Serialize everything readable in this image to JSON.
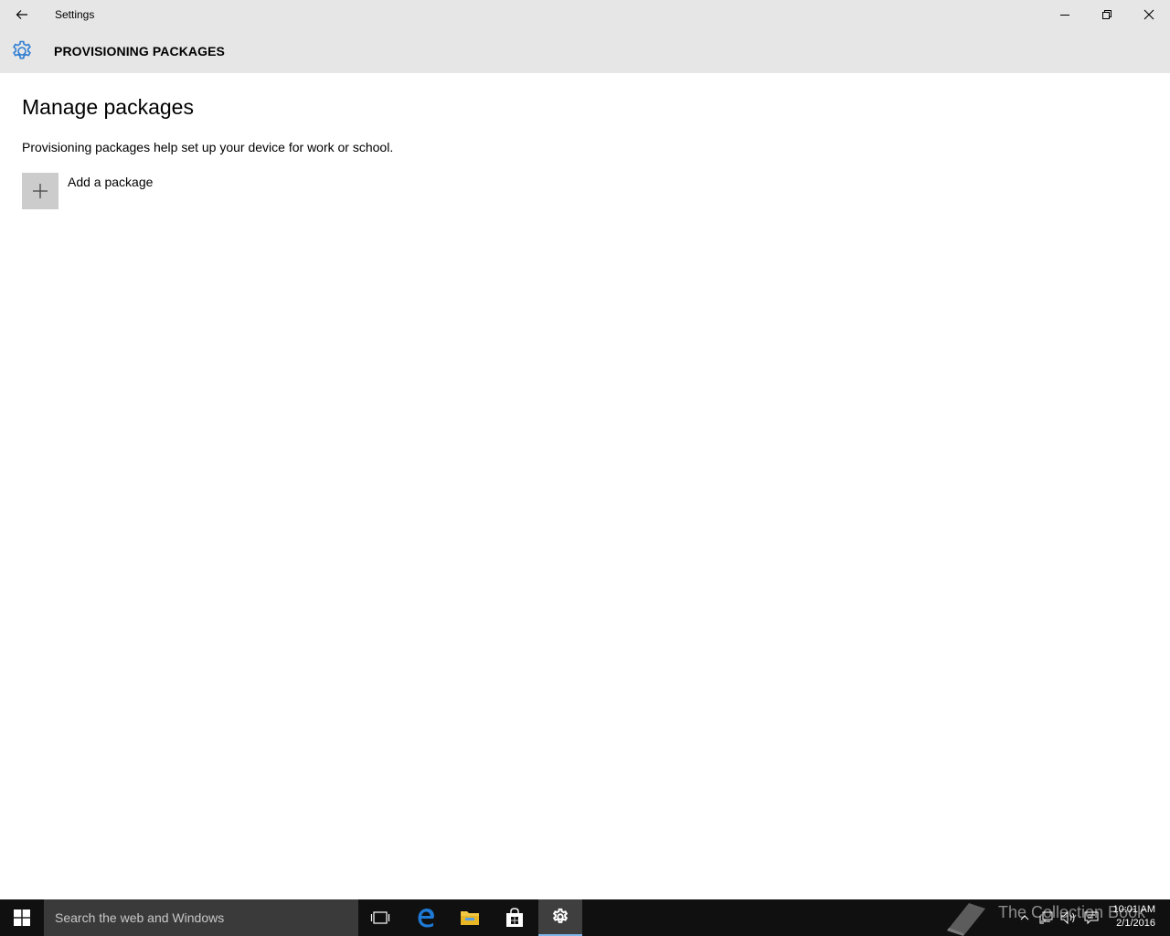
{
  "window": {
    "title": "Settings",
    "back_icon": "back-arrow-icon",
    "controls": [
      "minimize-icon",
      "restore-icon",
      "close-icon"
    ]
  },
  "header": {
    "icon": "gear-icon",
    "title": "PROVISIONING PACKAGES",
    "accent_color": "#2d7dd2"
  },
  "main": {
    "heading": "Manage packages",
    "description": "Provisioning packages help set up your device for work or school.",
    "add_button_label": "Add a package",
    "add_button_icon": "plus-icon"
  },
  "taskbar": {
    "start_icon": "windows-logo-icon",
    "search_placeholder": "Search the web and Windows",
    "apps": [
      "task-view-icon",
      "edge-icon",
      "file-explorer-icon",
      "store-icon",
      "settings-gear-icon"
    ],
    "active_app": "settings-gear-icon",
    "watermark": "The Collection Book",
    "tray_icons": [
      "chevron-up-icon",
      "network-icon",
      "volume-icon",
      "action-center-icon"
    ],
    "time": "10:01 AM",
    "date": "2/1/2016"
  }
}
